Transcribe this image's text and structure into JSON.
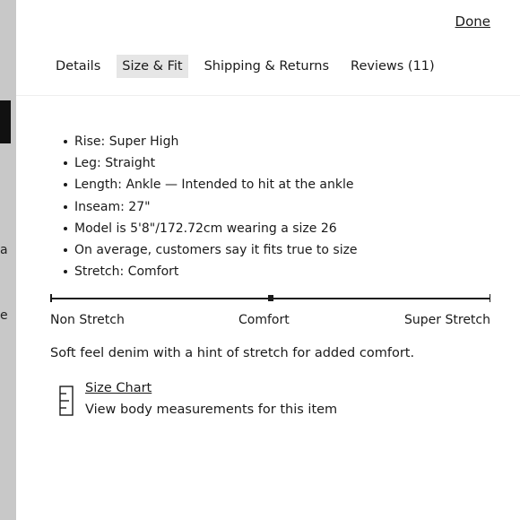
{
  "background_edge": {
    "letters": [
      "a",
      "e"
    ]
  },
  "header": {
    "done_label": "Done"
  },
  "tabs": [
    {
      "label": "Details",
      "active": false
    },
    {
      "label": "Size & Fit",
      "active": true
    },
    {
      "label": "Shipping & Returns",
      "active": false
    },
    {
      "label": "Reviews (11)",
      "active": false
    }
  ],
  "specs": [
    "Rise: Super High",
    "Leg: Straight",
    "Length: Ankle — Intended to hit at the ankle",
    "Inseam: 27\"",
    "Model is 5'8\"/172.72cm wearing a size 26",
    "On average, customers say it fits true to size",
    "Stretch: Comfort"
  ],
  "stretch_scale": {
    "labels": [
      "Non Stretch",
      "Comfort",
      "Super Stretch"
    ],
    "selected": "Comfort",
    "selected_fraction": 0.5
  },
  "description": "Soft feel denim with a hint of stretch for added comfort.",
  "size_chart": {
    "link_label": "Size Chart",
    "subtitle": "View body measurements for this item",
    "icon": "ruler-icon"
  },
  "colors": {
    "active_tab_bg": "#e6e6e6",
    "text": "#1a1a1a",
    "backdrop": "#c8c8c8"
  }
}
